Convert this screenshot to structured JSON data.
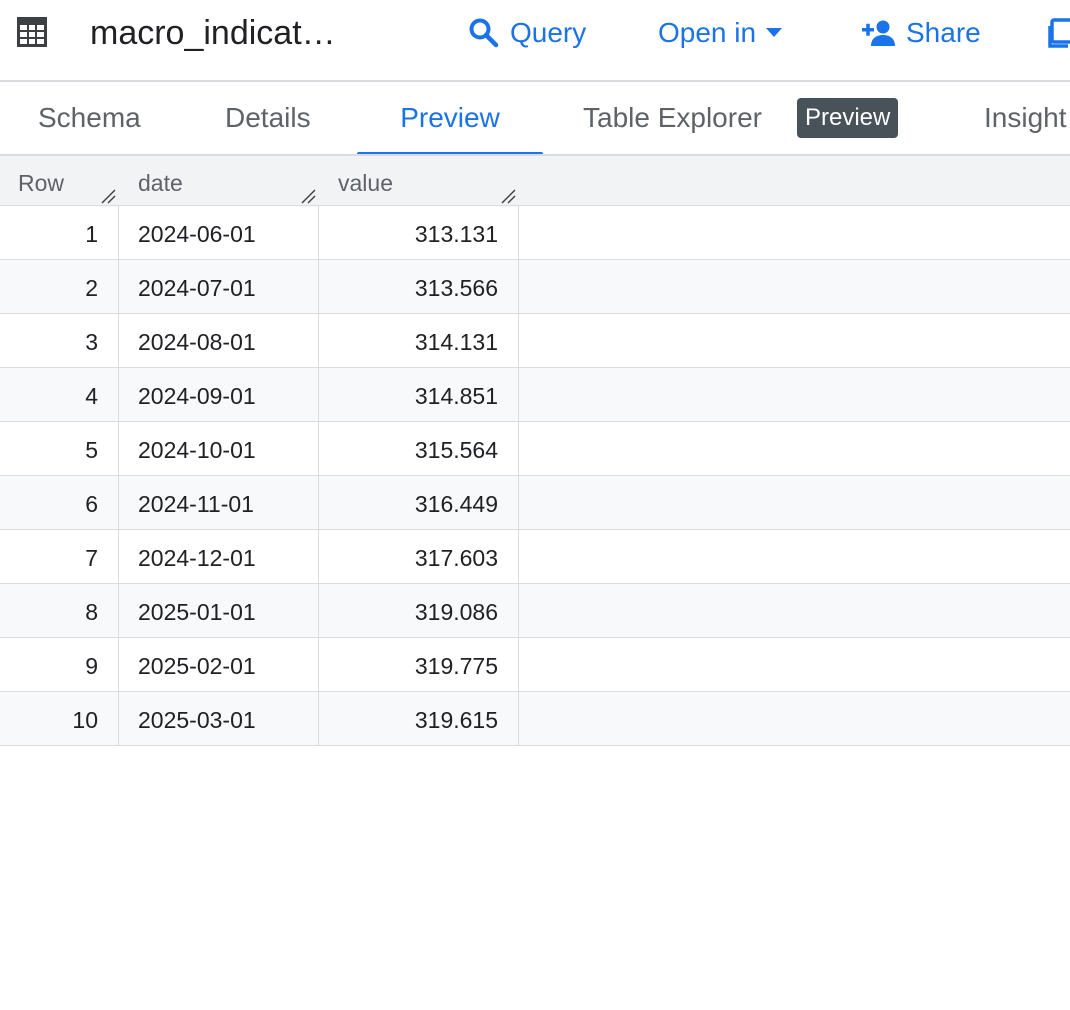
{
  "header": {
    "title": "macro_indicat…",
    "query_label": "Query",
    "open_in_label": "Open in",
    "share_label": "Share"
  },
  "tabs": [
    {
      "label": "Schema",
      "active": false
    },
    {
      "label": "Details",
      "active": false
    },
    {
      "label": "Preview",
      "active": true
    },
    {
      "label": "Table Explorer",
      "active": false,
      "badge": "Preview"
    },
    {
      "label": "Insight",
      "active": false
    }
  ],
  "table": {
    "columns": [
      "Row",
      "date",
      "value"
    ],
    "rows": [
      {
        "row": "1",
        "date": "2024-06-01",
        "value": "313.131"
      },
      {
        "row": "2",
        "date": "2024-07-01",
        "value": "313.566"
      },
      {
        "row": "3",
        "date": "2024-08-01",
        "value": "314.131"
      },
      {
        "row": "4",
        "date": "2024-09-01",
        "value": "314.851"
      },
      {
        "row": "5",
        "date": "2024-10-01",
        "value": "315.564"
      },
      {
        "row": "6",
        "date": "2024-11-01",
        "value": "316.449"
      },
      {
        "row": "7",
        "date": "2024-12-01",
        "value": "317.603"
      },
      {
        "row": "8",
        "date": "2025-01-01",
        "value": "319.086"
      },
      {
        "row": "9",
        "date": "2025-02-01",
        "value": "319.775"
      },
      {
        "row": "10",
        "date": "2025-03-01",
        "value": "319.615"
      }
    ]
  },
  "colors": {
    "accent": "#1a73e8",
    "badge_bg": "#475259",
    "header_bg": "#f1f3f4",
    "border": "#dadce0"
  },
  "icons": {
    "table": "table-icon",
    "query": "search-icon",
    "open_in": "caret-down-icon",
    "share": "person-add-icon",
    "copy": "copy-icon",
    "resize": "column-resize-icon"
  }
}
